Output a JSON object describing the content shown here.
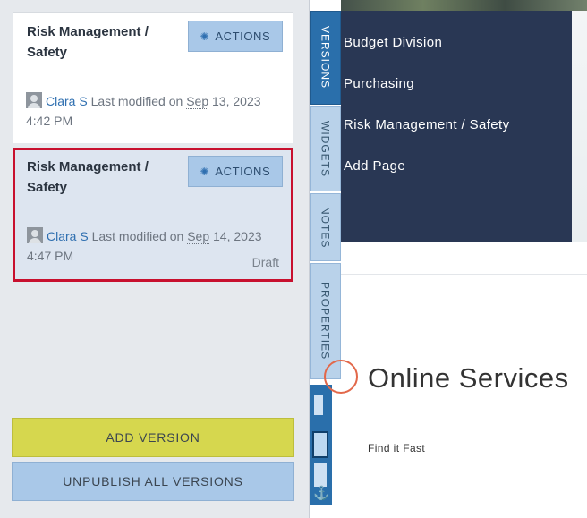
{
  "versions": [
    {
      "title": "Risk Management / Safety",
      "actions_label": "ACTIONS",
      "user": "Clara S",
      "modified_prefix": "Last modified on",
      "date_month": "Sep",
      "date_rest": "13, 2023 4:42 PM",
      "status": ""
    },
    {
      "title": "Risk Management / Safety",
      "actions_label": "ACTIONS",
      "user": "Clara S",
      "modified_prefix": "Last modified on",
      "date_month": "Sep",
      "date_rest": "14, 2023 4:47 PM",
      "status": "Draft"
    }
  ],
  "buttons": {
    "add_version": "ADD VERSION",
    "unpublish_all": "UNPUBLISH ALL VERSIONS"
  },
  "tabs": [
    "VERSIONS",
    "WIDGETS",
    "NOTES",
    "PROPERTIES"
  ],
  "nav_menu": [
    "Budget Division",
    "Purchasing",
    "Risk Management / Safety",
    "Add Page"
  ],
  "page": {
    "section_title": "Online Services",
    "link_text": "Find it Fast"
  },
  "colors": {
    "selected_border": "#c8102e",
    "add_button": "#d6d74e",
    "secondary_button": "#a9c8e8",
    "active_tab": "#2a6fab",
    "nav_background": "#293754"
  },
  "icons": [
    "gear-icon",
    "avatar",
    "anchor-icon",
    "online-services-icon"
  ]
}
